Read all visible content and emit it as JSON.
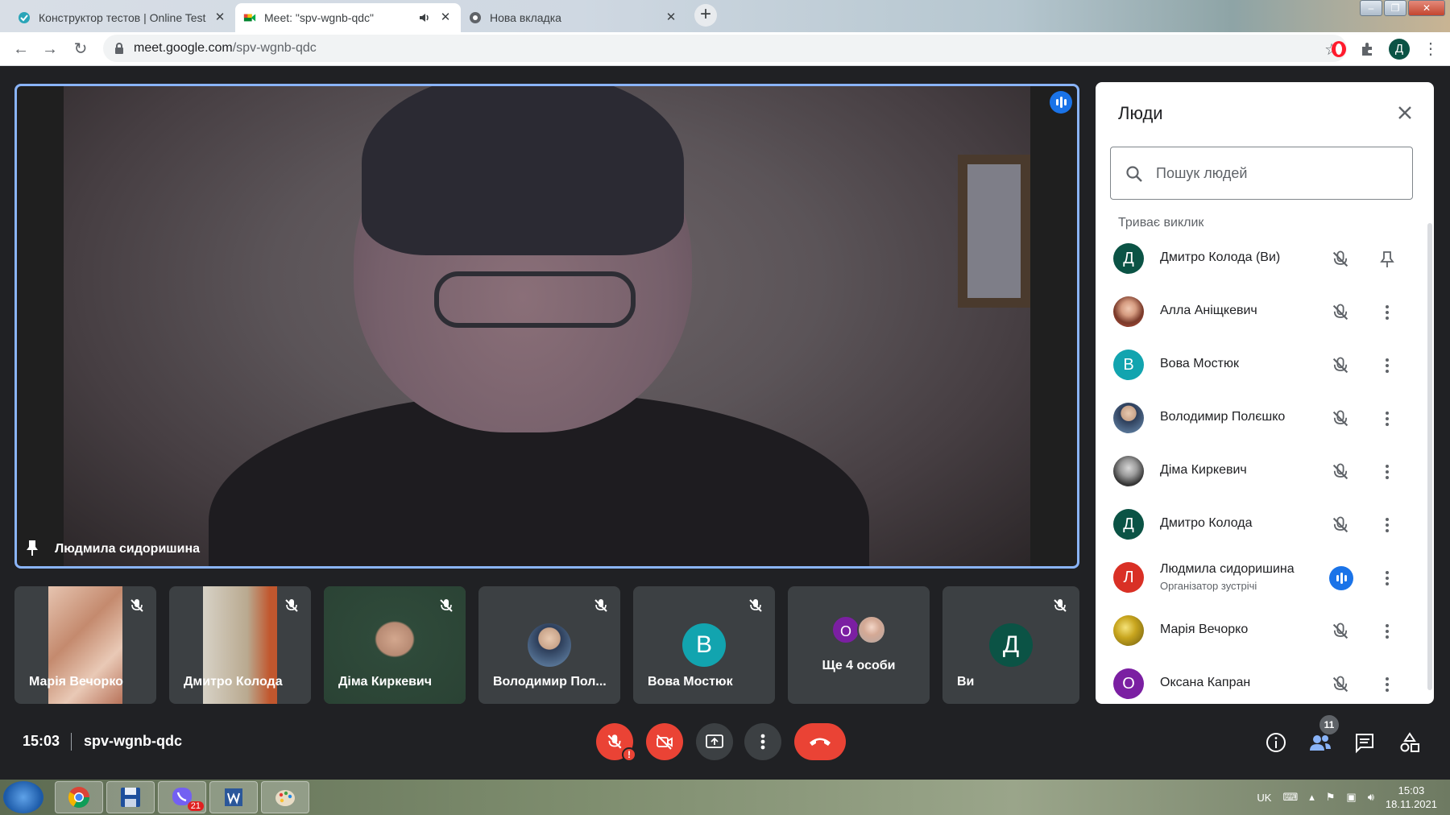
{
  "browser": {
    "tabs": [
      {
        "title": "Конструктор тестов | Online Test",
        "active": false
      },
      {
        "title": "Meet: \"spv-wgnb-qdc\"",
        "active": true
      },
      {
        "title": "Нова вкладка",
        "active": false
      }
    ],
    "url_host": "meet.google.com",
    "url_path": "/spv-wgnb-qdc",
    "profile_initial": "Д"
  },
  "stage": {
    "speaker_name": "Людмила сидоришина"
  },
  "thumbnails": [
    {
      "name": "Марія Вечорко",
      "type": "video"
    },
    {
      "name": "Дмитро Колода",
      "type": "video"
    },
    {
      "name": "Діма Киркевич",
      "type": "video"
    },
    {
      "name": "Володимир Пол...",
      "type": "photo"
    },
    {
      "name": "Вова Мостюк",
      "type": "avatar",
      "initial": "В",
      "color": "#12a4af"
    },
    {
      "name": "Ще 4 особи",
      "type": "more",
      "initial": "О"
    },
    {
      "name": "Ви",
      "type": "avatar",
      "initial": "Д",
      "color": "#0b5345"
    }
  ],
  "bottom_bar": {
    "time": "15:03",
    "meeting_code": "spv-wgnb-qdc",
    "participants_count": "11",
    "mic_alert": "!"
  },
  "people_panel": {
    "title": "Люди",
    "search_placeholder": "Пошук людей",
    "section_label": "Триває виклик",
    "people": [
      {
        "name": "Дмитро Колода (Ви)",
        "initial": "Д",
        "color": "#0b5345",
        "sub": "",
        "speaking": false
      },
      {
        "name": "Алла Аніщкевич",
        "initial": "",
        "color": "#8a5a4a",
        "sub": "",
        "speaking": false
      },
      {
        "name": "Вова Мостюк",
        "initial": "В",
        "color": "#12a4af",
        "sub": "",
        "speaking": false
      },
      {
        "name": "Володимир Полєшко",
        "initial": "",
        "color": "#6c8fb3",
        "sub": "",
        "speaking": false
      },
      {
        "name": "Діма Киркевич",
        "initial": "",
        "color": "#555",
        "sub": "",
        "speaking": false
      },
      {
        "name": "Дмитро Колода",
        "initial": "Д",
        "color": "#0b5345",
        "sub": "",
        "speaking": false
      },
      {
        "name": "Людмила сидоришина",
        "initial": "Л",
        "color": "#d93025",
        "sub": "Організатор зустрічі",
        "speaking": true
      },
      {
        "name": "Марія Вечорко",
        "initial": "",
        "color": "#b8a020",
        "sub": "",
        "speaking": false
      },
      {
        "name": "Оксана Капран",
        "initial": "О",
        "color": "#7b1fa2",
        "sub": "",
        "speaking": false
      }
    ]
  },
  "taskbar": {
    "language": "UK",
    "time": "15:03",
    "date": "18.11.2021",
    "viber_badge": "21"
  },
  "colors": {
    "accent_blue": "#1a73e8",
    "danger_red": "#ea4335",
    "meet_bg": "#202124",
    "tile_bg": "#3c4043"
  }
}
